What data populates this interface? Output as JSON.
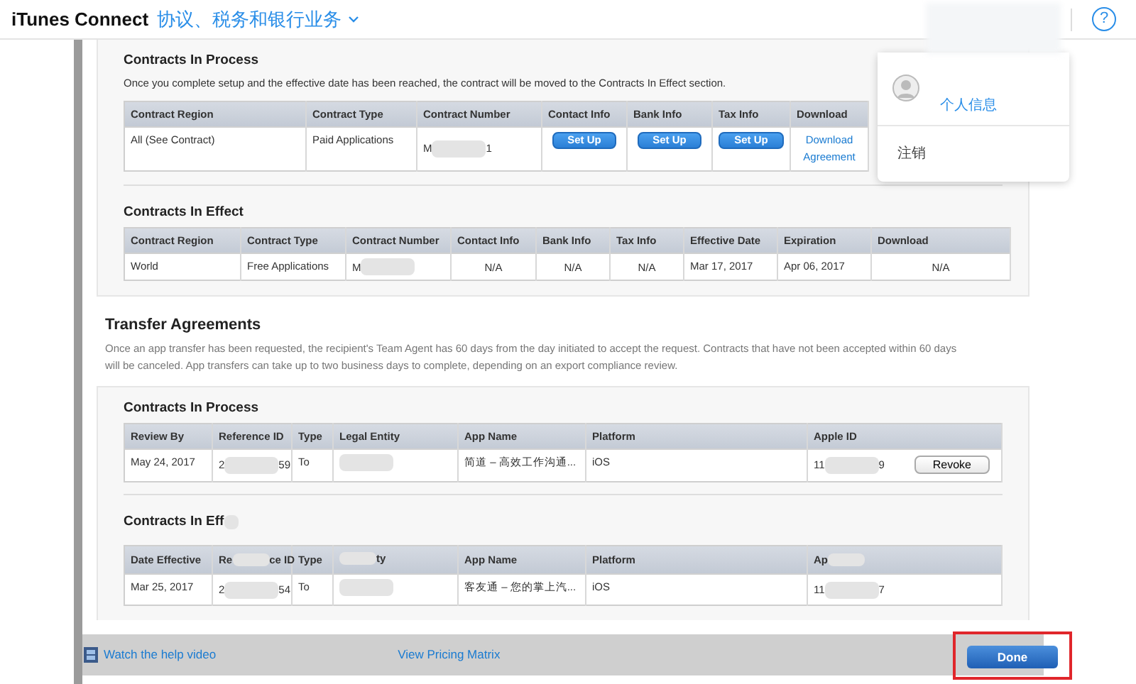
{
  "header": {
    "brand": "iTunes Connect",
    "section": "协议、税务和银行业务",
    "help": "?"
  },
  "agreements": {
    "in_process": {
      "title": "Contracts In Process",
      "note": "Once you complete setup and the effective date has been reached, the contract will be moved to the Contracts In Effect section.",
      "columns": [
        "Contract Region",
        "Contract Type",
        "Contract Number",
        "Contact Info",
        "Bank Info",
        "Tax Info",
        "Download"
      ],
      "rows": [
        [
          {
            "kind": "text",
            "text": "All (See Contract)"
          },
          {
            "kind": "text",
            "text": "Paid Applications"
          },
          {
            "kind": "redacted",
            "before": "M",
            "after": "1"
          },
          {
            "kind": "button",
            "text": "Set Up"
          },
          {
            "kind": "button",
            "text": "Set Up"
          },
          {
            "kind": "button",
            "text": "Set Up"
          },
          {
            "kind": "link",
            "text": "Download Agreement"
          }
        ]
      ]
    },
    "in_effect": {
      "title": "Contracts In Effect",
      "columns": [
        "Contract Region",
        "Contract Type",
        "Contract Number",
        "Contact Info",
        "Bank Info",
        "Tax Info",
        "Effective Date",
        "Expiration",
        "Download"
      ],
      "rows": [
        [
          {
            "kind": "text",
            "text": "World"
          },
          {
            "kind": "text",
            "text": "Free Applications"
          },
          {
            "kind": "redacted",
            "before": "M"
          },
          {
            "kind": "center",
            "text": "N/A"
          },
          {
            "kind": "center",
            "text": "N/A"
          },
          {
            "kind": "center",
            "text": "N/A"
          },
          {
            "kind": "text",
            "text": "Mar 17, 2017"
          },
          {
            "kind": "text",
            "text": "Apr 06, 2017"
          },
          {
            "kind": "center",
            "text": "N/A"
          }
        ]
      ]
    }
  },
  "transfer": {
    "title": "Transfer Agreements",
    "note": "Once an app transfer has been requested, the recipient's Team Agent has 60 days from the day initiated to accept the request. Contracts that have not been accepted within 60 days will be canceled. App transfers can take up to two business days to complete, depending on an export compliance review.",
    "in_process": {
      "title": "Contracts In Process",
      "columns": [
        {
          "kind": "text",
          "text": "Review By"
        },
        {
          "kind": "text",
          "text": "Reference ID"
        },
        {
          "kind": "text",
          "text": "Type"
        },
        {
          "kind": "text",
          "text": "Legal Entity"
        },
        {
          "kind": "text",
          "text": "App Name"
        },
        {
          "kind": "text",
          "text": "Platform"
        },
        {
          "kind": "text",
          "text": "Apple ID"
        }
      ],
      "rows": [
        [
          {
            "kind": "text",
            "text": "May 24, 2017"
          },
          {
            "kind": "redacted",
            "before": "2",
            "after": "59"
          },
          {
            "kind": "text",
            "text": "To"
          },
          {
            "kind": "redacted"
          },
          {
            "kind": "text",
            "text": "简道 – 高效工作沟通..."
          },
          {
            "kind": "text",
            "text": "iOS"
          },
          {
            "kind": "redacted_action",
            "before": "11",
            "after": "9",
            "action": "Revoke"
          }
        ]
      ]
    },
    "in_effect": {
      "title": "Contracts In Eff",
      "columns": [
        {
          "kind": "text",
          "text": "Date Effective"
        },
        {
          "kind": "redacted",
          "before": "Re",
          "after": "ce ID"
        },
        {
          "kind": "text",
          "text": "Type"
        },
        {
          "kind": "redacted",
          "after": "ty"
        },
        {
          "kind": "text",
          "text": "App Name"
        },
        {
          "kind": "text",
          "text": "Platform"
        },
        {
          "kind": "redacted",
          "before": "Ap"
        }
      ],
      "rows": [
        [
          {
            "kind": "text",
            "text": "Mar 25, 2017"
          },
          {
            "kind": "redacted",
            "before": "2",
            "after": "54"
          },
          {
            "kind": "text",
            "text": "To"
          },
          {
            "kind": "redacted"
          },
          {
            "kind": "text",
            "text": "客友通 – 您的掌上汽..."
          },
          {
            "kind": "text",
            "text": "iOS"
          },
          {
            "kind": "redacted",
            "before": "11",
            "after": "7"
          }
        ]
      ]
    }
  },
  "footer": {
    "help_link": "Watch the help video",
    "pricing_link": "View Pricing Matrix",
    "done": "Done"
  },
  "account_menu": {
    "items": [
      {
        "kind": "profile",
        "text": "个人信息"
      },
      {
        "kind": "plain",
        "text": "注销"
      }
    ]
  }
}
